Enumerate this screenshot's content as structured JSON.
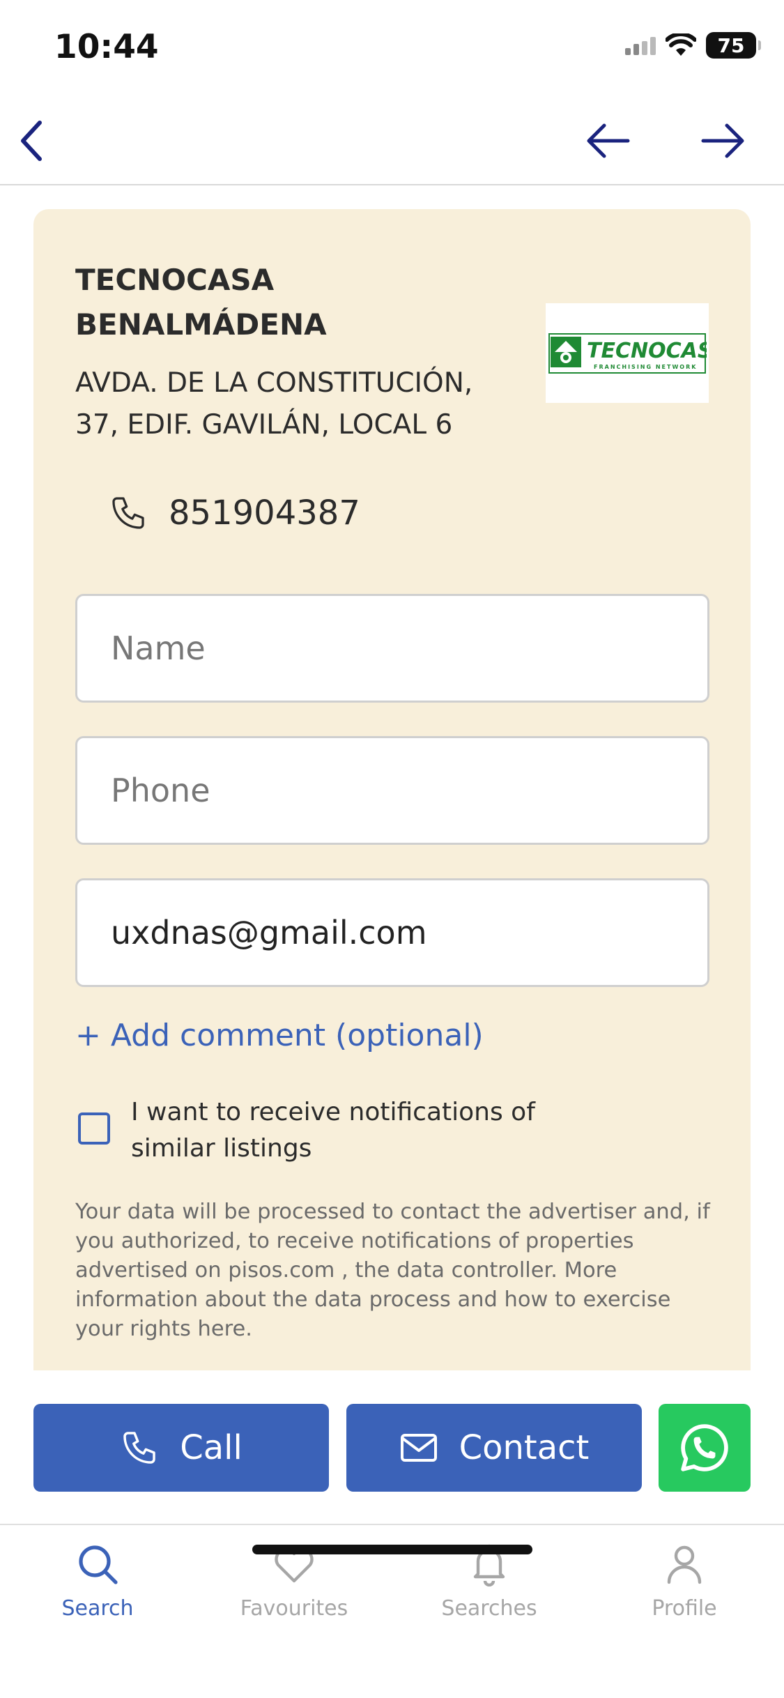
{
  "status_bar": {
    "time": "10:44",
    "battery": "75"
  },
  "agency": {
    "name": "TECNOCASA BENALMÁDENA",
    "address": "AVDA. DE LA CONSTITUCIÓN, 37, EDIF. GAVILÁN, LOCAL 6",
    "phone": "851904387",
    "logo_text": "TECNOCASA",
    "logo_subtext": "FRANCHISING NETWORK"
  },
  "form": {
    "name_placeholder": "Name",
    "phone_placeholder": "Phone",
    "email_value": "uxdnas@gmail.com",
    "add_comment": "+ Add comment (optional)",
    "notifications_label": "I want to receive notifications of similar listings",
    "legal_text": "Your data will be processed to contact the advertiser and, if you authorized, to receive notifications of properties advertised on pisos.com , the data controller. More information about the data process and how to exercise your rights here."
  },
  "actions": {
    "call": "Call",
    "contact": "Contact"
  },
  "tabs": [
    {
      "label": "Search"
    },
    {
      "label": "Favourites"
    },
    {
      "label": "Searches"
    },
    {
      "label": "Profile"
    }
  ],
  "colors": {
    "accent": "#3b62b8",
    "card_bg": "#f8efda",
    "whatsapp": "#27c95f",
    "nav_icon": "#1a237e"
  }
}
